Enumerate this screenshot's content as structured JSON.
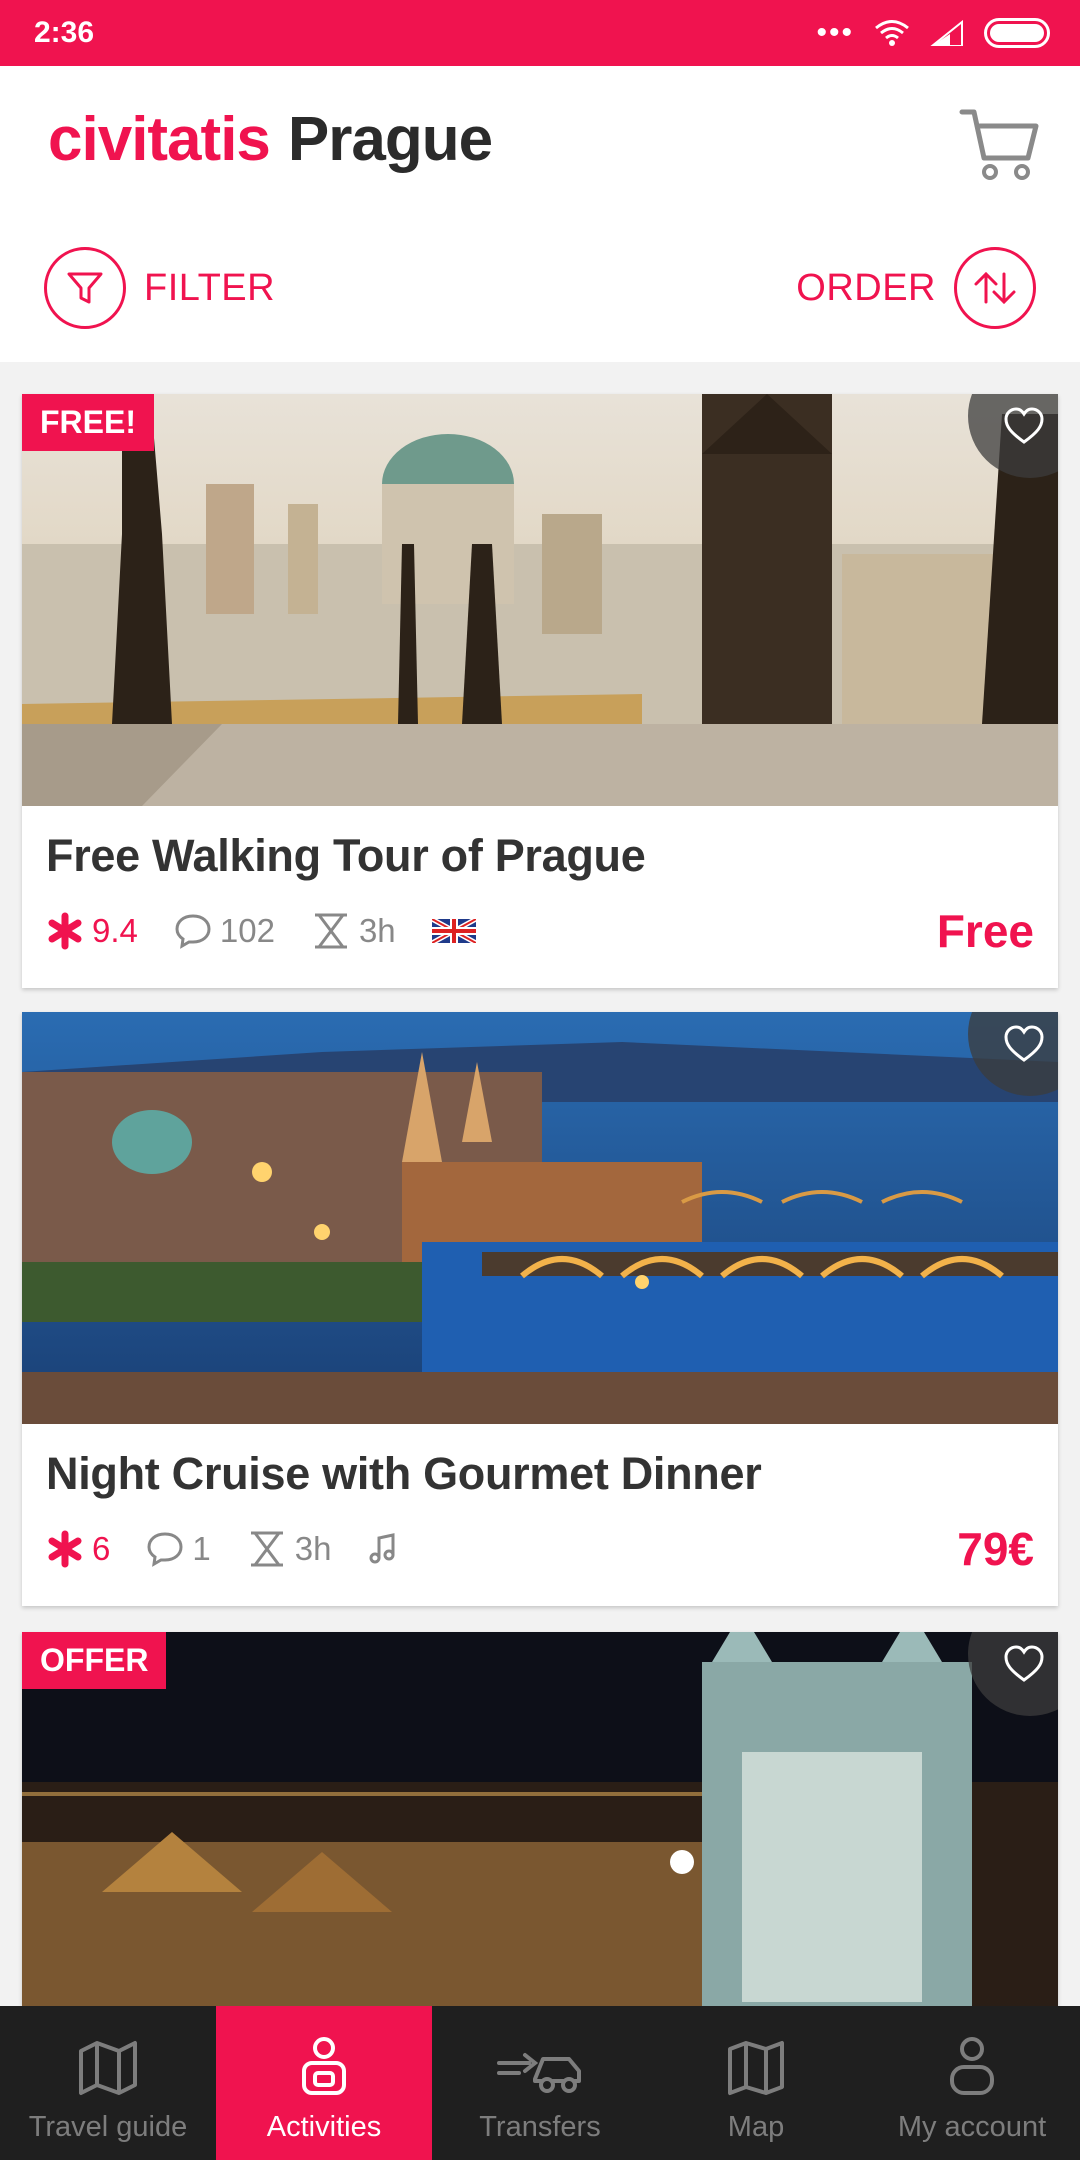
{
  "status": {
    "time": "2:36"
  },
  "header": {
    "brand": "civitatis",
    "city": "Prague"
  },
  "controls": {
    "filter_label": "FILTER",
    "order_label": "ORDER"
  },
  "cards": [
    {
      "badge": "FREE!",
      "title": "Free Walking Tour of Prague",
      "rating": "9.4",
      "comments": "102",
      "duration": "3h",
      "price": "Free"
    },
    {
      "badge": "",
      "title": "Night Cruise with Gourmet Dinner",
      "rating": "6",
      "comments": "1",
      "duration": "3h",
      "price": "79€"
    },
    {
      "badge": "OFFER",
      "title": "",
      "rating": "",
      "comments": "",
      "duration": "",
      "price": ""
    }
  ],
  "tabs": [
    {
      "label": "Travel guide",
      "icon": "map-guide-icon"
    },
    {
      "label": "Activities",
      "icon": "activities-icon"
    },
    {
      "label": "Transfers",
      "icon": "transfer-car-icon"
    },
    {
      "label": "Map",
      "icon": "map-icon"
    },
    {
      "label": "My account",
      "icon": "account-icon"
    }
  ],
  "colors": {
    "brand": "#f0134f",
    "tabbar": "#1f1f1f",
    "text": "#333333"
  }
}
